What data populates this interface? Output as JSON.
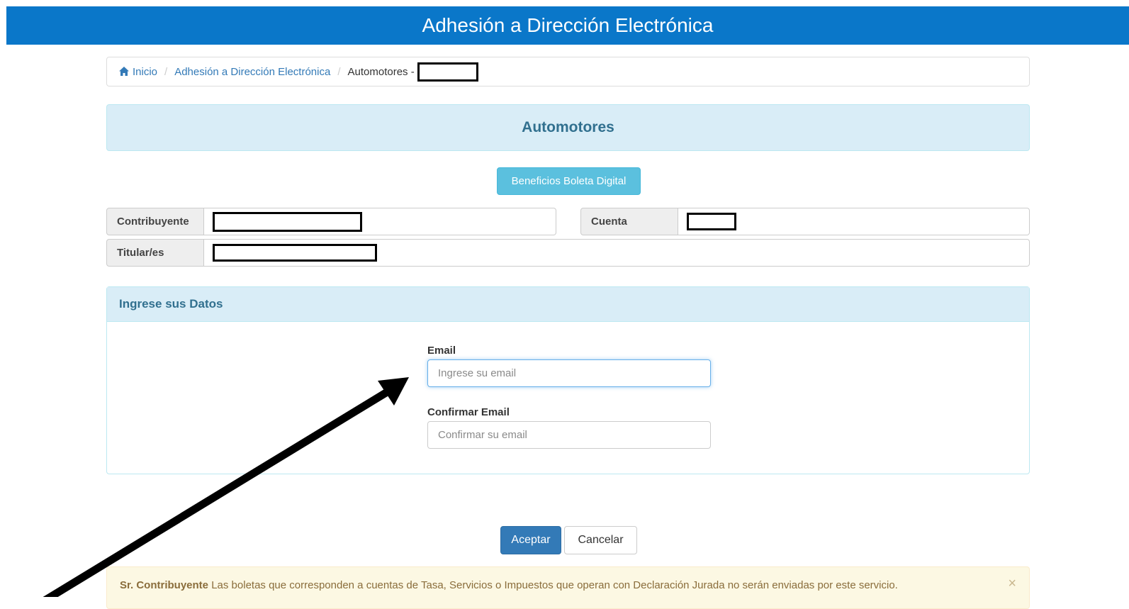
{
  "header": {
    "title": "Adhesión a Dirección Electrónica"
  },
  "breadcrumb": {
    "home": "Inicio",
    "section": "Adhesión a Dirección Electrónica",
    "current": "Automotores -"
  },
  "banner": {
    "title": "Automotores"
  },
  "benefits_button": "Beneficios Boleta Digital",
  "info": {
    "contribuyente_label": "Contribuyente",
    "cuenta_label": "Cuenta",
    "titulares_label": "Titular/es"
  },
  "form": {
    "panel_title": "Ingrese sus Datos",
    "email_label": "Email",
    "email_placeholder": "Ingrese su email",
    "confirm_label": "Confirmar Email",
    "confirm_placeholder": "Confirmar su email"
  },
  "actions": {
    "accept": "Aceptar",
    "cancel": "Cancelar"
  },
  "alert": {
    "strong": "Sr. Contribuyente",
    "text": " Las boletas que corresponden a cuentas de Tasa, Servicios o Impuestos que operan con Declaración Jurada no serán enviadas por este servicio.",
    "close": "×"
  },
  "colors": {
    "topbar": "#0a77c9",
    "primary": "#337ab7",
    "info": "#5bc0de",
    "panel_heading": "#d9edf7",
    "warning_bg": "#fcf8e3"
  }
}
